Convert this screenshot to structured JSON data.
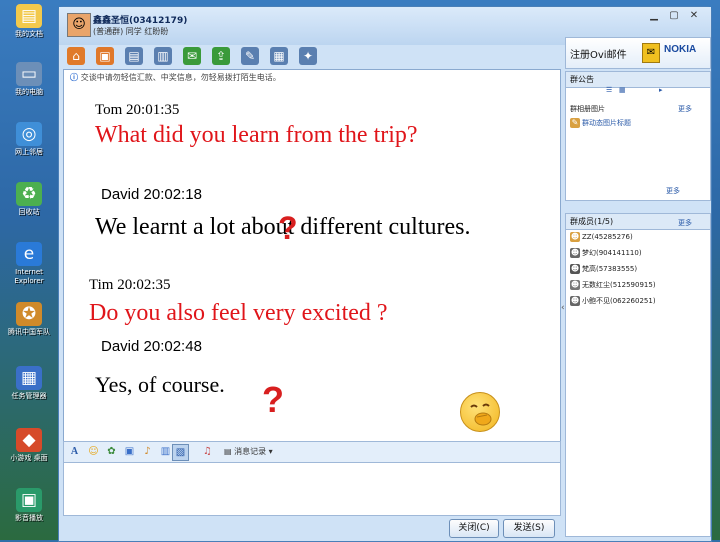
{
  "desktop": {
    "icons": [
      {
        "label": "我的文档",
        "icon": "folder-icon",
        "color": "#f2c94c",
        "glyph": "▤"
      },
      {
        "label": "我的电脑",
        "icon": "computer-icon",
        "color": "#6c8fb8",
        "glyph": "▭"
      },
      {
        "label": "网上邻居",
        "icon": "network-icon",
        "color": "#3f8fd8",
        "glyph": "◎"
      },
      {
        "label": "回收站",
        "icon": "recycle-bin-icon",
        "color": "#4caf50",
        "glyph": "♻"
      },
      {
        "label": "Internet Explorer",
        "icon": "ie-icon",
        "color": "#2a7ad8",
        "glyph": "e"
      },
      {
        "label": "腾讯中国军队",
        "icon": "game-icon",
        "color": "#d08a2a",
        "glyph": "✪"
      },
      {
        "label": "任务管理器",
        "icon": "task-manager-icon",
        "color": "#3a6fc8",
        "glyph": "▦"
      },
      {
        "label": "小游戏 桌面",
        "icon": "penguin-icon",
        "color": "#d64a2a",
        "glyph": "◆"
      },
      {
        "label": "影音播放",
        "icon": "media-icon",
        "color": "#2a9a6a",
        "glyph": "▣"
      }
    ]
  },
  "window": {
    "title": "鑫鑫圣恒(03412179)",
    "subtitle": "(普通群) 同学 红盼盼",
    "controls": [
      "▁",
      "▢",
      "✕"
    ],
    "nokia_logo": "NOKIA",
    "banner_text": "注册Ovi邮件",
    "toolbar_icons": [
      {
        "name": "home-icon",
        "color": "#e07a2a",
        "glyph": "⌂"
      },
      {
        "name": "video-call-icon",
        "color": "#e0782a",
        "glyph": "▣"
      },
      {
        "name": "doc-icon",
        "color": "#5a7fb0",
        "glyph": "▤"
      },
      {
        "name": "file-icon",
        "color": "#5a7fb0",
        "glyph": "▥"
      },
      {
        "name": "mail-icon",
        "color": "#3a9a3a",
        "glyph": "✉"
      },
      {
        "name": "share-icon",
        "color": "#3a9a3a",
        "glyph": "⇪"
      },
      {
        "name": "tools-icon",
        "color": "#5a7fb0",
        "glyph": "✎"
      },
      {
        "name": "app-icon",
        "color": "#5a7fb0",
        "glyph": "▦"
      },
      {
        "name": "settings-icon",
        "color": "#5a7fb0",
        "glyph": "✦"
      }
    ]
  },
  "chat": {
    "notice": "交谈中请勿轻信汇款、中奖信息，勿轻易拨打陌生电话。",
    "messages": [
      {
        "sender": "Tom 20:01:35",
        "text": "What did you learn from the trip?"
      },
      {
        "sender": "David 20:02:18",
        "text": "We learnt a lot about different cultures."
      },
      {
        "sender": "Tim 20:02:35",
        "text": "Do you also feel very excited ?"
      },
      {
        "sender": "David 20:02:48",
        "text": "Yes, of course."
      }
    ],
    "question_mark": "?",
    "accent_color": "#e0151a"
  },
  "format_toolbar": {
    "font_label": "A",
    "history_label": "消息记录"
  },
  "send_bar": {
    "close_label": "关闭(C)",
    "send_label": "发送(S)"
  },
  "sidebar": {
    "announcement_head": "群公告",
    "announcement_title": "群相册图片",
    "announcement_more": "更多",
    "announcement_item": "群动态图片标题",
    "members_head": "群成员(1/5)",
    "members_more": "更多",
    "members": [
      "ZZ(45285276)",
      "梦幻(904141110)",
      "梵高(57383555)",
      "无数红尘(512590915)",
      "小鲍不见(062260251)"
    ]
  }
}
